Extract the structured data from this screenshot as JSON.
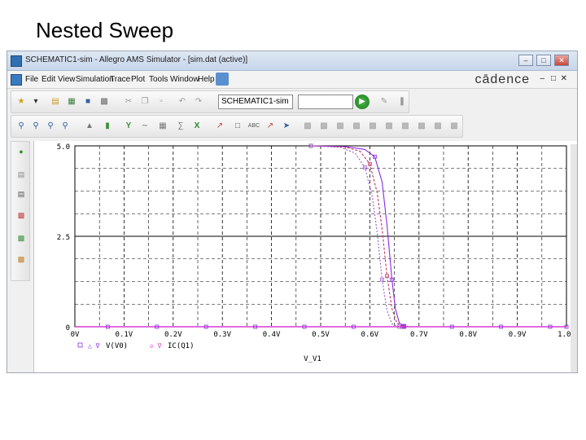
{
  "slide": {
    "title": "Nested Sweep"
  },
  "window": {
    "title": "SCHEMATIC1-sim - Allegro AMS Simulator - [sim.dat (active)]"
  },
  "menu": {
    "items": [
      "File",
      "Edit",
      "View",
      "Simulation",
      "Trace",
      "Plot",
      "Tools",
      "Window",
      "Help"
    ],
    "brand": "cādence"
  },
  "toolbar": {
    "profile": "SCHEMATIC1-sim",
    "run_icon": "play-icon"
  },
  "colors": {
    "purple": "#8a2be2",
    "magenta": "#d63ad6",
    "pink": "#c83264",
    "grid": "#000000",
    "axis": "#000000"
  },
  "chart_data": {
    "type": "line",
    "xlabel": "V_V1",
    "xlim": [
      0,
      1.0
    ],
    "ylim": [
      0,
      5.0
    ],
    "x_ticks": [
      "0V",
      "0.1V",
      "0.2V",
      "0.3V",
      "0.4V",
      "0.5V",
      "0.6V",
      "0.7V",
      "0.8V",
      "0.9V",
      "1.0V"
    ],
    "y_ticks": [
      "5.0",
      "2.5",
      "0"
    ],
    "legend": [
      "V(V0)",
      "IC(Q1)"
    ],
    "series": [
      {
        "name": "V(V0)",
        "color": "#8a2be2",
        "x": [
          0.48,
          0.55,
          0.59,
          0.61,
          0.625,
          0.635,
          0.645,
          0.652,
          0.66,
          0.67,
          0.68,
          0.7,
          1.0
        ],
        "y": [
          5.0,
          4.98,
          4.9,
          4.7,
          4.0,
          2.8,
          1.3,
          0.5,
          0.1,
          0.02,
          0.0,
          0.0,
          0.0
        ]
      },
      {
        "name": "",
        "color": "#c83264",
        "x": [
          0.48,
          0.55,
          0.58,
          0.6,
          0.615,
          0.625,
          0.635,
          0.645,
          0.655,
          0.67,
          0.7,
          1.0
        ],
        "y": [
          5.0,
          4.97,
          4.85,
          4.5,
          3.7,
          2.7,
          1.4,
          0.5,
          0.1,
          0.0,
          0.0,
          0.0
        ]
      },
      {
        "name": "",
        "color": "#9b59d0",
        "x": [
          0.48,
          0.54,
          0.57,
          0.59,
          0.605,
          0.615,
          0.625,
          0.635,
          0.645,
          0.66,
          0.7,
          1.0
        ],
        "y": [
          5.0,
          4.96,
          4.8,
          4.4,
          3.6,
          2.6,
          1.3,
          0.45,
          0.08,
          0.0,
          0.0,
          0.0
        ]
      },
      {
        "name": "IC(Q1)",
        "color": "#d63ad6",
        "x": [
          0.0,
          1.0
        ],
        "y": [
          0.0,
          0.0
        ]
      }
    ]
  }
}
